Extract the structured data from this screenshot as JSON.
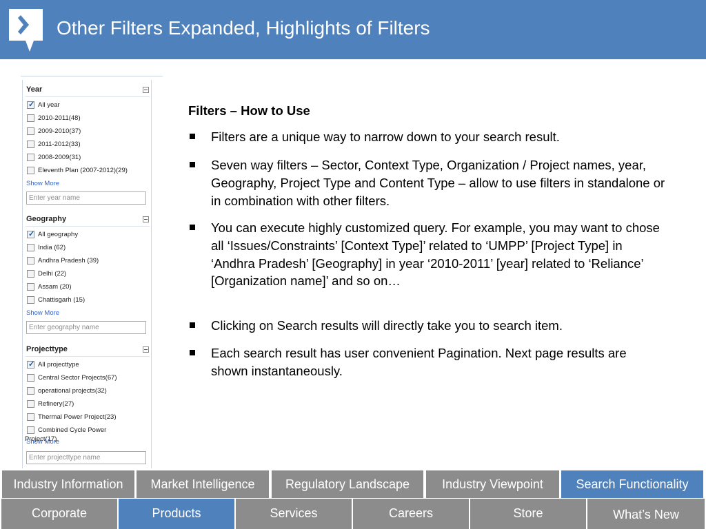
{
  "header": {
    "title": "Other Filters Expanded, Highlights of Filters"
  },
  "filters": {
    "year": {
      "title": "Year",
      "options": [
        {
          "label": "All year",
          "checked": true
        },
        {
          "label": "2010-2011(48)",
          "checked": false
        },
        {
          "label": "2009-2010(37)",
          "checked": false
        },
        {
          "label": "2011-2012(33)",
          "checked": false
        },
        {
          "label": "2008-2009(31)",
          "checked": false
        },
        {
          "label": "Eleventh Plan (2007-2012)(29)",
          "checked": false
        }
      ],
      "show_more": "Show More",
      "placeholder": "Enter year name"
    },
    "geography": {
      "title": "Geography",
      "options": [
        {
          "label": "All geography",
          "checked": true
        },
        {
          "label": "India (62)",
          "checked": false
        },
        {
          "label": "Andhra Pradesh (39)",
          "checked": false
        },
        {
          "label": "Delhi (22)",
          "checked": false
        },
        {
          "label": "Assam (20)",
          "checked": false
        },
        {
          "label": "Chattisgarh (15)",
          "checked": false
        }
      ],
      "show_more": "Show More",
      "placeholder": "Enter geography name"
    },
    "projecttype": {
      "title": "Projecttype",
      "options": [
        {
          "label": "All projecttype",
          "checked": true
        },
        {
          "label": "Central Sector Projects(67)",
          "checked": false
        },
        {
          "label": "operational projects(32)",
          "checked": false
        },
        {
          "label": "Refinery(27)",
          "checked": false
        },
        {
          "label": "Thermal Power Project(23)",
          "checked": false
        },
        {
          "label": "Combined Cycle Power",
          "checked": false
        }
      ],
      "overflow_text": "Project(17)",
      "show_more": "Show More",
      "placeholder": "Enter projecttype name"
    }
  },
  "content": {
    "heading": "Filters – How to Use",
    "bullets": [
      "Filters are a unique way to narrow down to your search result.",
      "Seven way filters – Sector, Context Type, Organization / Project names, year, Geography, Project Type and Content Type – allow to use filters in standalone or in combination with other filters.",
      "You can execute highly customized query. For example, you may want to chose all ‘Issues/Constraints’ [Context Type]’ related to ‘UMPP’ [Project Type] in ‘Andhra Pradesh’ [Geography] in year ‘2010-2011’ [year] related to ‘Reliance’ [Organization name]’ and so on…",
      "Clicking on Search results will directly take you to search item.",
      "Each search result has user convenient Pagination. Next page results are shown instantaneously."
    ]
  },
  "nav_primary": [
    {
      "label": "Industry Information",
      "active": false
    },
    {
      "label": "Market Intelligence",
      "active": false
    },
    {
      "label": "Regulatory Landscape",
      "active": false
    },
    {
      "label": "Industry Viewpoint",
      "active": false
    },
    {
      "label": "Search Functionality",
      "active": true
    }
  ],
  "nav_secondary": [
    {
      "label": "Corporate",
      "active": false
    },
    {
      "label": "Products",
      "active": true
    },
    {
      "label": "Services",
      "active": false
    },
    {
      "label": "Careers",
      "active": false
    },
    {
      "label": "Store",
      "active": false
    },
    {
      "label": "What’s New",
      "active": false
    }
  ],
  "colors": {
    "header_bg": "#4f81bd",
    "nav_bg": "#8c8c8c",
    "nav_active_bg": "#4f81bd",
    "link": "#3366cc"
  }
}
